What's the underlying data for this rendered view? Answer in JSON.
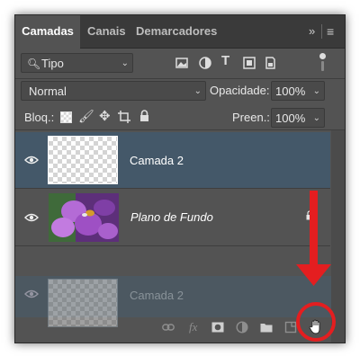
{
  "tabs": [
    {
      "label": "Camadas",
      "active": true
    },
    {
      "label": "Canais",
      "active": false
    },
    {
      "label": "Demarcadores",
      "active": false
    }
  ],
  "filter": {
    "kind_label": "Tipo",
    "icons": [
      "image-filter-icon",
      "adjustment-filter-icon",
      "type-filter-icon",
      "shape-filter-icon",
      "smart-object-filter-icon",
      "filter-toggle-icon"
    ]
  },
  "blend": {
    "mode": "Normal",
    "opacity_label": "Opacidade:",
    "opacity_value": "100%"
  },
  "lock": {
    "label": "Bloq.:",
    "fill_label": "Preen.:",
    "fill_value": "100%"
  },
  "layers": [
    {
      "name": "Camada 2",
      "visible": true,
      "selected": true,
      "italic": false
    },
    {
      "name": "Plano de Fundo",
      "visible": true,
      "selected": false,
      "italic": true
    },
    {
      "name": "Camada 2",
      "visible": true,
      "selected": true,
      "italic": false,
      "dragging": true
    }
  ],
  "bottom_icons": [
    "link-icon",
    "fx-icon",
    "mask-icon",
    "adjustment-icon",
    "folder-icon",
    "new-layer-icon",
    "hand-cursor-icon"
  ],
  "fx_label": "fx",
  "annotation": {
    "color": "#e41e20"
  },
  "colors": {
    "panel": "#535353",
    "selected_row": "#445869",
    "tabbar": "#3a3a3a"
  }
}
